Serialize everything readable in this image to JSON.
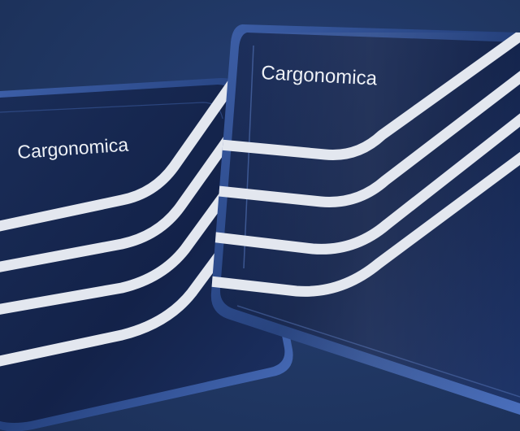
{
  "cards": [
    {
      "brand": "Cargonomica"
    },
    {
      "brand": "Cargonomica"
    }
  ],
  "colors": {
    "background": "#203763",
    "card_body": "#13224a",
    "card_edge": "#2c4c8c",
    "stripe": "#e3e7ef"
  }
}
